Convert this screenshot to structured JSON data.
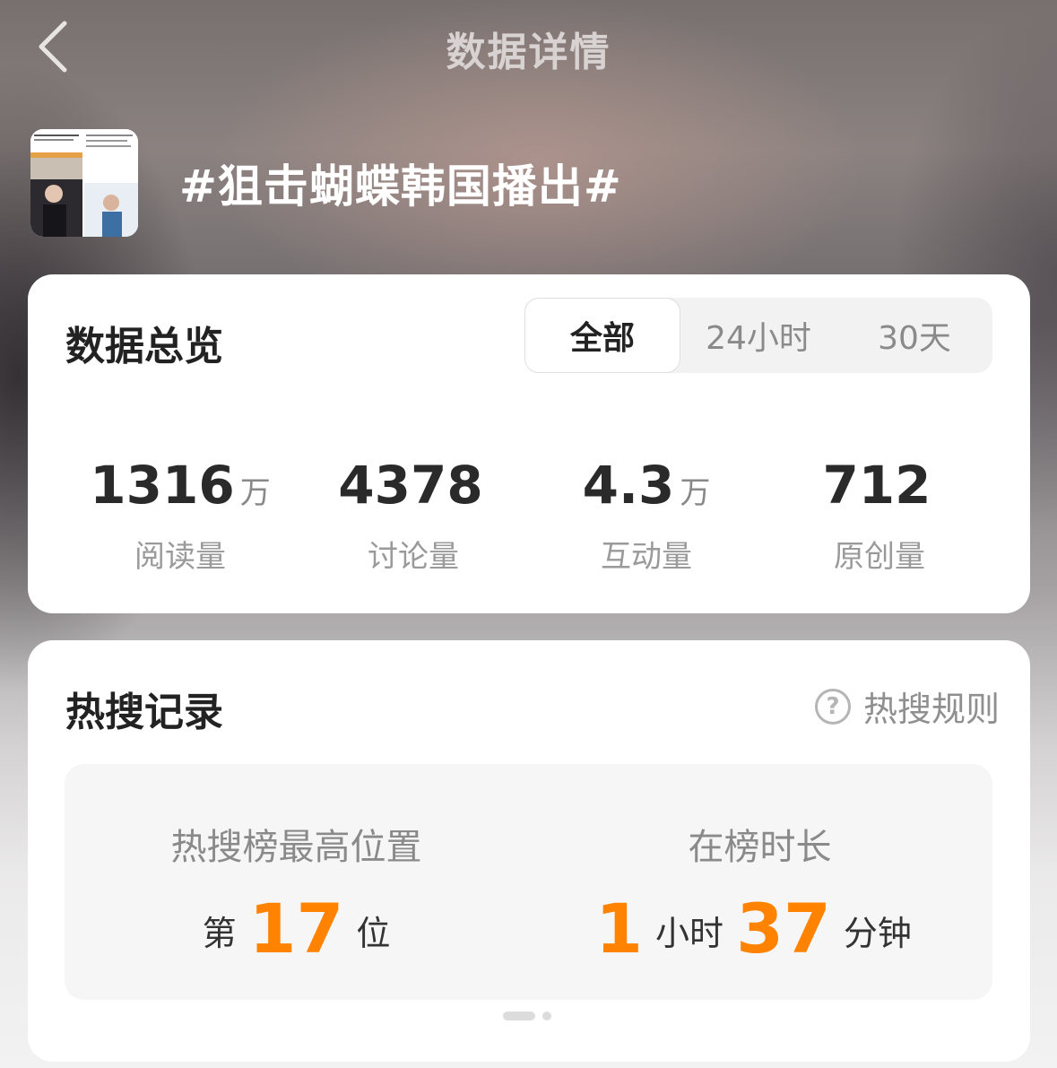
{
  "header": {
    "title": "数据详情"
  },
  "topic": {
    "title": "#狙击蝴蝶韩国播出#"
  },
  "overview": {
    "title": "数据总览",
    "tabs": [
      "全部",
      "24小时",
      "30天"
    ],
    "active_tab": "全部",
    "stats": [
      {
        "value": "1316",
        "unit": "万",
        "label": "阅读量"
      },
      {
        "value": "4378",
        "unit": "",
        "label": "讨论量"
      },
      {
        "value": "4.3",
        "unit": "万",
        "label": "互动量"
      },
      {
        "value": "712",
        "unit": "",
        "label": "原创量"
      }
    ]
  },
  "hot": {
    "title": "热搜记录",
    "rules_label": "热搜规则",
    "peak": {
      "label": "热搜榜最高位置",
      "prefix": "第",
      "value": "17",
      "suffix": "位"
    },
    "duration": {
      "label": "在榜时长",
      "hours": "1",
      "hours_unit": "小时",
      "minutes": "37",
      "minutes_unit": "分钟"
    }
  },
  "colors": {
    "accent": "#ff8200"
  }
}
